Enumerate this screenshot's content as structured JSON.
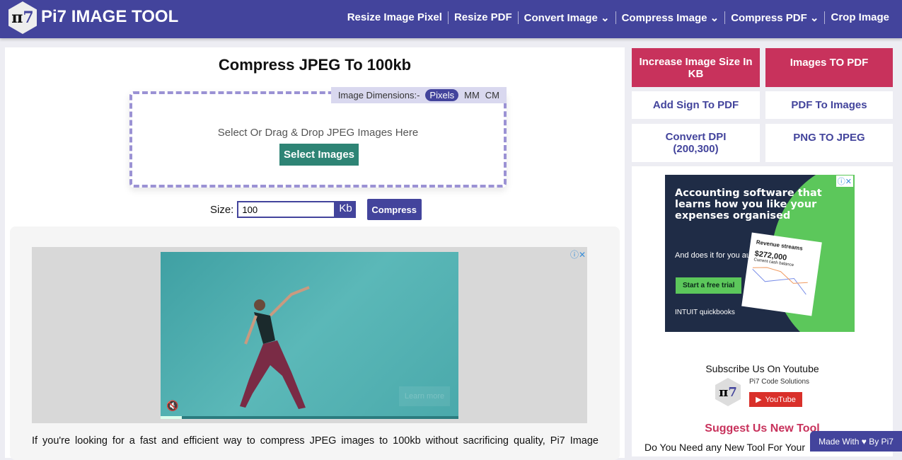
{
  "header": {
    "logo_text": "π7",
    "brand": "Pi7 IMAGE TOOL",
    "nav": [
      "Resize Image Pixel",
      "Resize PDF",
      "Convert Image ⌄",
      "Compress Image ⌄",
      "Compress PDF ⌄",
      "Crop Image"
    ]
  },
  "main": {
    "title": "Compress JPEG To 100kb",
    "dims_label": "Image Dimensions:-",
    "dims": [
      "Pixels",
      "MM",
      "CM"
    ],
    "drop_text": "Select Or Drag & Drop JPEG Images Here",
    "select_button": "Select Images",
    "size_label": "Size:",
    "size_value": "100",
    "size_unit": "Kb",
    "compress_button": "Compress",
    "video_learn_more": "Learn more",
    "paragraph": "If you're looking for a fast and efficient way to compress JPEG images to 100kb without sacrificing quality, Pi7 Image"
  },
  "sidebar": {
    "buttons": [
      "Increase Image Size In KB",
      "Images TO PDF",
      "Add Sign To PDF",
      "PDF To Images",
      "Convert DPI (200,300)",
      "PNG TO JPEG"
    ],
    "ad": {
      "headline": "Accounting software that learns how you like your expenses organised",
      "sub": "And does it for you automatically.",
      "cta": "Start a free trial",
      "card_title": "Revenue streams",
      "card_value": "$272,000",
      "card_caption": "Current cash balance",
      "brand": "INTUIT quickbooks"
    },
    "subscribe": "Subscribe Us On Youtube",
    "channel": "Pi7 Code Solutions",
    "youtube": "YouTube",
    "suggest": "Suggest Us New Tool",
    "ask": "Do You Need any New Tool For Your"
  },
  "footer": {
    "made_with": "Made With ♥ By Pi7"
  }
}
